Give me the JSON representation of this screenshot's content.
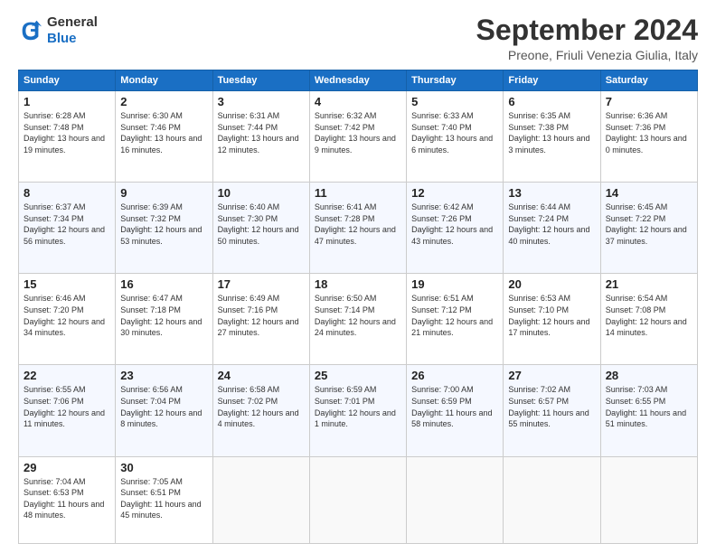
{
  "header": {
    "logo_line1": "General",
    "logo_line2": "Blue",
    "main_title": "September 2024",
    "subtitle": "Preone, Friuli Venezia Giulia, Italy"
  },
  "calendar": {
    "headers": [
      "Sunday",
      "Monday",
      "Tuesday",
      "Wednesday",
      "Thursday",
      "Friday",
      "Saturday"
    ],
    "weeks": [
      [
        {
          "day": "1",
          "sunrise": "Sunrise: 6:28 AM",
          "sunset": "Sunset: 7:48 PM",
          "daylight": "Daylight: 13 hours and 19 minutes."
        },
        {
          "day": "2",
          "sunrise": "Sunrise: 6:30 AM",
          "sunset": "Sunset: 7:46 PM",
          "daylight": "Daylight: 13 hours and 16 minutes."
        },
        {
          "day": "3",
          "sunrise": "Sunrise: 6:31 AM",
          "sunset": "Sunset: 7:44 PM",
          "daylight": "Daylight: 13 hours and 12 minutes."
        },
        {
          "day": "4",
          "sunrise": "Sunrise: 6:32 AM",
          "sunset": "Sunset: 7:42 PM",
          "daylight": "Daylight: 13 hours and 9 minutes."
        },
        {
          "day": "5",
          "sunrise": "Sunrise: 6:33 AM",
          "sunset": "Sunset: 7:40 PM",
          "daylight": "Daylight: 13 hours and 6 minutes."
        },
        {
          "day": "6",
          "sunrise": "Sunrise: 6:35 AM",
          "sunset": "Sunset: 7:38 PM",
          "daylight": "Daylight: 13 hours and 3 minutes."
        },
        {
          "day": "7",
          "sunrise": "Sunrise: 6:36 AM",
          "sunset": "Sunset: 7:36 PM",
          "daylight": "Daylight: 13 hours and 0 minutes."
        }
      ],
      [
        {
          "day": "8",
          "sunrise": "Sunrise: 6:37 AM",
          "sunset": "Sunset: 7:34 PM",
          "daylight": "Daylight: 12 hours and 56 minutes."
        },
        {
          "day": "9",
          "sunrise": "Sunrise: 6:39 AM",
          "sunset": "Sunset: 7:32 PM",
          "daylight": "Daylight: 12 hours and 53 minutes."
        },
        {
          "day": "10",
          "sunrise": "Sunrise: 6:40 AM",
          "sunset": "Sunset: 7:30 PM",
          "daylight": "Daylight: 12 hours and 50 minutes."
        },
        {
          "day": "11",
          "sunrise": "Sunrise: 6:41 AM",
          "sunset": "Sunset: 7:28 PM",
          "daylight": "Daylight: 12 hours and 47 minutes."
        },
        {
          "day": "12",
          "sunrise": "Sunrise: 6:42 AM",
          "sunset": "Sunset: 7:26 PM",
          "daylight": "Daylight: 12 hours and 43 minutes."
        },
        {
          "day": "13",
          "sunrise": "Sunrise: 6:44 AM",
          "sunset": "Sunset: 7:24 PM",
          "daylight": "Daylight: 12 hours and 40 minutes."
        },
        {
          "day": "14",
          "sunrise": "Sunrise: 6:45 AM",
          "sunset": "Sunset: 7:22 PM",
          "daylight": "Daylight: 12 hours and 37 minutes."
        }
      ],
      [
        {
          "day": "15",
          "sunrise": "Sunrise: 6:46 AM",
          "sunset": "Sunset: 7:20 PM",
          "daylight": "Daylight: 12 hours and 34 minutes."
        },
        {
          "day": "16",
          "sunrise": "Sunrise: 6:47 AM",
          "sunset": "Sunset: 7:18 PM",
          "daylight": "Daylight: 12 hours and 30 minutes."
        },
        {
          "day": "17",
          "sunrise": "Sunrise: 6:49 AM",
          "sunset": "Sunset: 7:16 PM",
          "daylight": "Daylight: 12 hours and 27 minutes."
        },
        {
          "day": "18",
          "sunrise": "Sunrise: 6:50 AM",
          "sunset": "Sunset: 7:14 PM",
          "daylight": "Daylight: 12 hours and 24 minutes."
        },
        {
          "day": "19",
          "sunrise": "Sunrise: 6:51 AM",
          "sunset": "Sunset: 7:12 PM",
          "daylight": "Daylight: 12 hours and 21 minutes."
        },
        {
          "day": "20",
          "sunrise": "Sunrise: 6:53 AM",
          "sunset": "Sunset: 7:10 PM",
          "daylight": "Daylight: 12 hours and 17 minutes."
        },
        {
          "day": "21",
          "sunrise": "Sunrise: 6:54 AM",
          "sunset": "Sunset: 7:08 PM",
          "daylight": "Daylight: 12 hours and 14 minutes."
        }
      ],
      [
        {
          "day": "22",
          "sunrise": "Sunrise: 6:55 AM",
          "sunset": "Sunset: 7:06 PM",
          "daylight": "Daylight: 12 hours and 11 minutes."
        },
        {
          "day": "23",
          "sunrise": "Sunrise: 6:56 AM",
          "sunset": "Sunset: 7:04 PM",
          "daylight": "Daylight: 12 hours and 8 minutes."
        },
        {
          "day": "24",
          "sunrise": "Sunrise: 6:58 AM",
          "sunset": "Sunset: 7:02 PM",
          "daylight": "Daylight: 12 hours and 4 minutes."
        },
        {
          "day": "25",
          "sunrise": "Sunrise: 6:59 AM",
          "sunset": "Sunset: 7:01 PM",
          "daylight": "Daylight: 12 hours and 1 minute."
        },
        {
          "day": "26",
          "sunrise": "Sunrise: 7:00 AM",
          "sunset": "Sunset: 6:59 PM",
          "daylight": "Daylight: 11 hours and 58 minutes."
        },
        {
          "day": "27",
          "sunrise": "Sunrise: 7:02 AM",
          "sunset": "Sunset: 6:57 PM",
          "daylight": "Daylight: 11 hours and 55 minutes."
        },
        {
          "day": "28",
          "sunrise": "Sunrise: 7:03 AM",
          "sunset": "Sunset: 6:55 PM",
          "daylight": "Daylight: 11 hours and 51 minutes."
        }
      ],
      [
        {
          "day": "29",
          "sunrise": "Sunrise: 7:04 AM",
          "sunset": "Sunset: 6:53 PM",
          "daylight": "Daylight: 11 hours and 48 minutes."
        },
        {
          "day": "30",
          "sunrise": "Sunrise: 7:05 AM",
          "sunset": "Sunset: 6:51 PM",
          "daylight": "Daylight: 11 hours and 45 minutes."
        },
        null,
        null,
        null,
        null,
        null
      ]
    ]
  }
}
